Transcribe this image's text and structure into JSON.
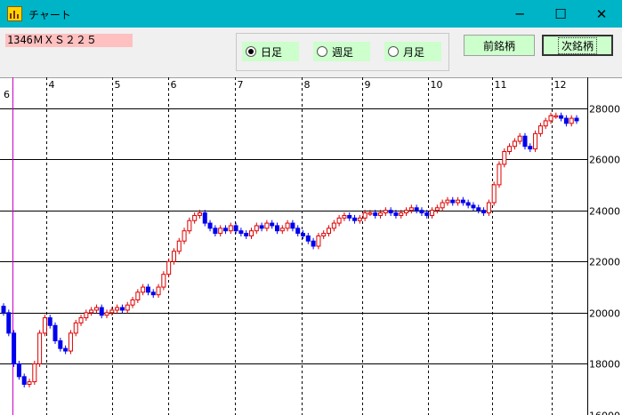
{
  "window": {
    "title": "チャート",
    "icon": "chart-app-icon",
    "controls": {
      "minimize": "─",
      "maximize": "☐",
      "close": "✕"
    }
  },
  "toolbar": {
    "stock_code": "1346ＭＸＳ２２５",
    "period_options": [
      {
        "label": "日足",
        "selected": true
      },
      {
        "label": "週足",
        "selected": false
      },
      {
        "label": "月足",
        "selected": false
      }
    ],
    "prev_button": "前銘柄",
    "next_button": "次銘柄"
  },
  "colors": {
    "up": "#dd0000",
    "down": "#0000ee",
    "accent": "#cc00cc",
    "background": "#ffffff",
    "button": "#ccffcc",
    "code_bg": "#ffc0c0"
  },
  "chart_data": {
    "type": "candlestick",
    "months": [
      "6",
      "4",
      "5",
      "6",
      "7",
      "8",
      "9",
      "10",
      "11",
      "12"
    ],
    "y_ticks": [
      16000,
      18000,
      20000,
      22000,
      24000,
      26000,
      28000
    ],
    "ylim": [
      16000,
      29200
    ],
    "grid": true,
    "series": [
      {
        "name": "",
        "values": [
          20000,
          19200,
          18000,
          17500,
          17200,
          17300,
          18000,
          19200,
          19800,
          19500,
          18900,
          18600,
          18500,
          19200,
          19600,
          19800,
          20000,
          20100,
          20200,
          19900,
          20000,
          20100,
          20200,
          20100,
          20300,
          20500,
          20800,
          21000,
          20800,
          20700,
          21000,
          21500,
          22000,
          22400,
          22800,
          23200,
          23600,
          23800,
          23900,
          23500,
          23300,
          23100,
          23300,
          23200,
          23400,
          23200,
          23100,
          23000,
          23200,
          23400,
          23300,
          23500,
          23400,
          23200,
          23300,
          23500,
          23300,
          23100,
          23000,
          22800,
          22600,
          23000,
          23100,
          23300,
          23500,
          23700,
          23800,
          23700,
          23600,
          23700,
          23900,
          23900,
          23800,
          23900,
          24000,
          23900,
          23800,
          23900,
          24000,
          24100,
          24000,
          23900,
          23800,
          24000,
          24100,
          24300,
          24400,
          24300,
          24400,
          24300,
          24200,
          24100,
          24000,
          23900,
          24300,
          25000,
          25800,
          26300,
          26500,
          26700,
          26900,
          26500,
          26400,
          27000,
          27300,
          27500,
          27700,
          27700,
          27600,
          27400,
          27600,
          27500
        ]
      }
    ]
  }
}
